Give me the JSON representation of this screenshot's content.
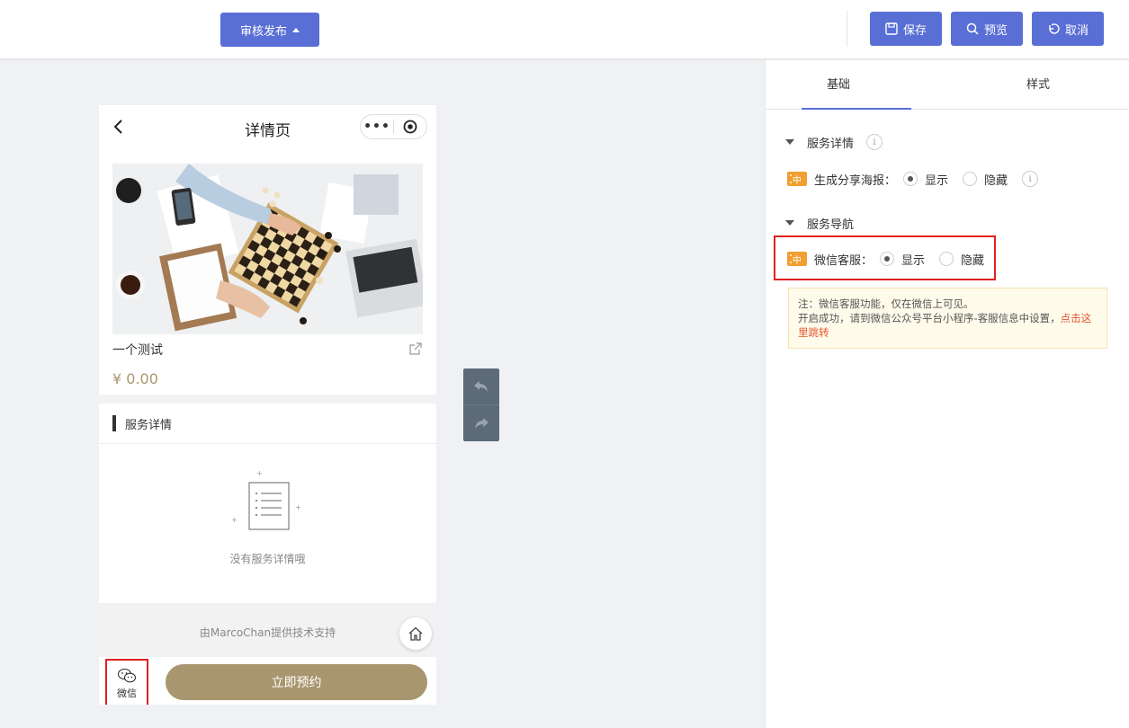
{
  "toolbar": {
    "publish_label": "审核发布",
    "save_label": "保存",
    "preview_label": "预览",
    "cancel_label": "取消",
    "accent_color": "#5a6fd6"
  },
  "phone": {
    "title": "详情页",
    "product_name": "一个测试",
    "price": "¥ 0.00",
    "section_title": "服务详情",
    "empty_text": "没有服务详情哦",
    "support_text": "由MarcoChan提供技术支持",
    "wechat_label": "微信",
    "book_label": "立即预约",
    "brand_color": "#a8966f"
  },
  "panel": {
    "tabs": [
      "基础",
      "样式"
    ],
    "active_tab": "基础",
    "group_service_detail": "服务详情",
    "share_poster_label": "生成分享海报：",
    "group_service_nav": "服务导航",
    "wechat_service_label": "微信客服：",
    "option_show": "显示",
    "option_hide": "隐藏",
    "tag_text": "中",
    "share_poster_value": "显示",
    "wechat_service_value": "显示",
    "notice_line1": "注：微信客服功能，仅在微信上可见。",
    "notice_line2": "开启成功，请到微信公众号平台小程序-客服信息中设置，",
    "notice_link": "点击这里跳转"
  },
  "icons": {
    "publish_caret": "caret-up-icon",
    "save": "floppy-disk-icon",
    "preview": "magnifier-icon",
    "cancel": "undo-arrow-icon",
    "back": "chevron-left-icon",
    "more": "more-dots-icon",
    "target": "record-target-icon",
    "share": "share-external-icon",
    "home": "home-icon",
    "wechat": "wechat-icon",
    "undo": "undo-icon",
    "redo": "redo-icon",
    "info": "info-icon"
  }
}
